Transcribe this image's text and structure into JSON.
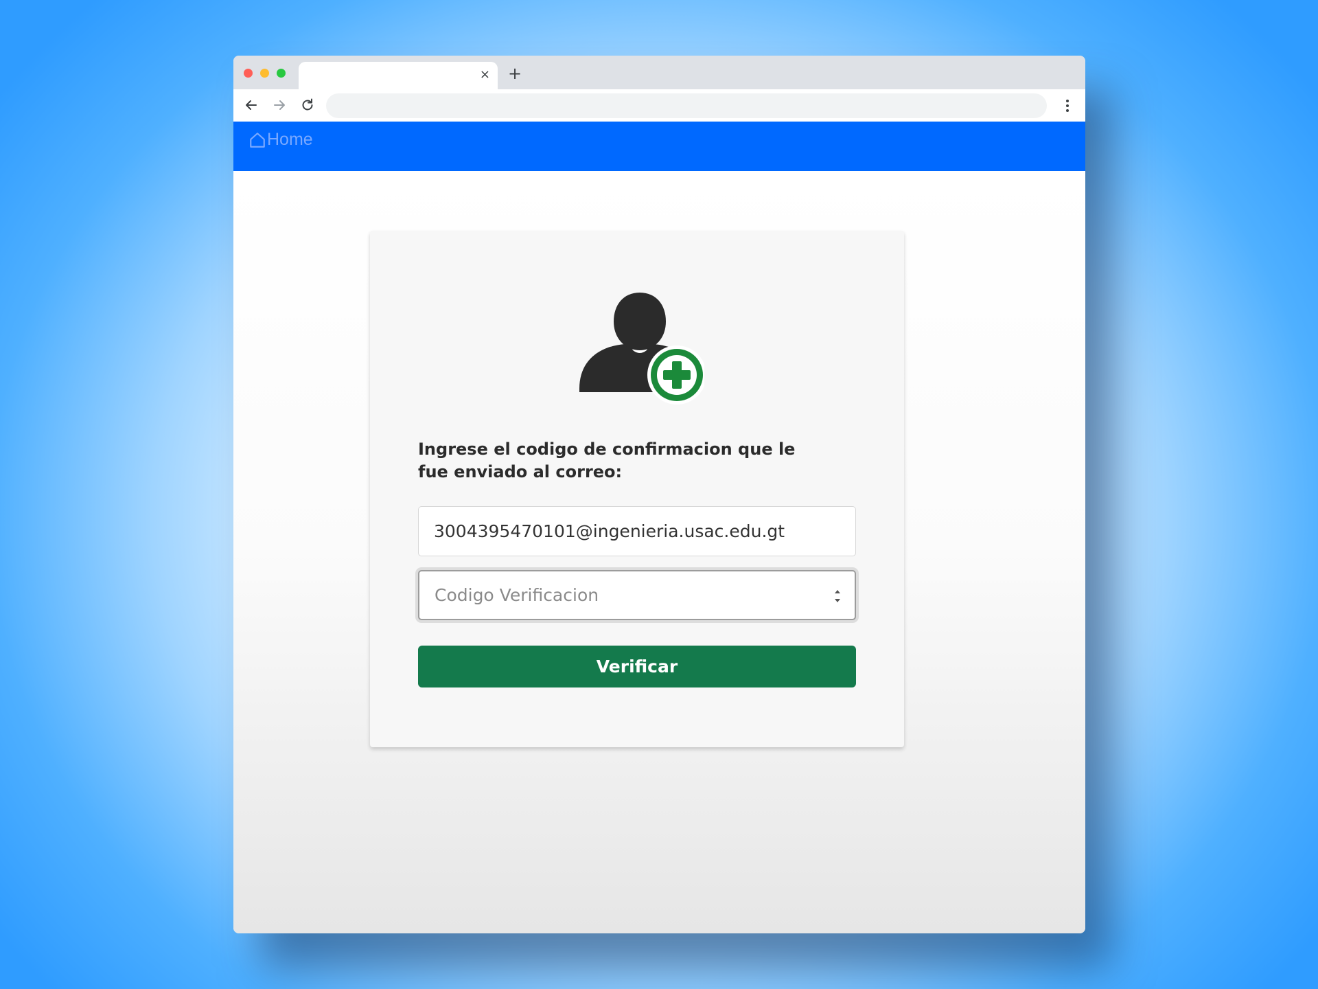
{
  "browser": {
    "tab_close_glyph": "×",
    "new_tab_glyph": "+"
  },
  "navbar": {
    "home_label": "Home",
    "color": "#0069ff"
  },
  "verification_form": {
    "prompt": "Ingrese el codigo de confirmacion que le fue enviado al correo:",
    "email_value": "3004395470101@ingenieria.usac.edu.gt",
    "code_placeholder": "Codigo Verificacion",
    "submit_label": "Verificar",
    "submit_color": "#147a4c",
    "icon": "user-add-icon"
  }
}
